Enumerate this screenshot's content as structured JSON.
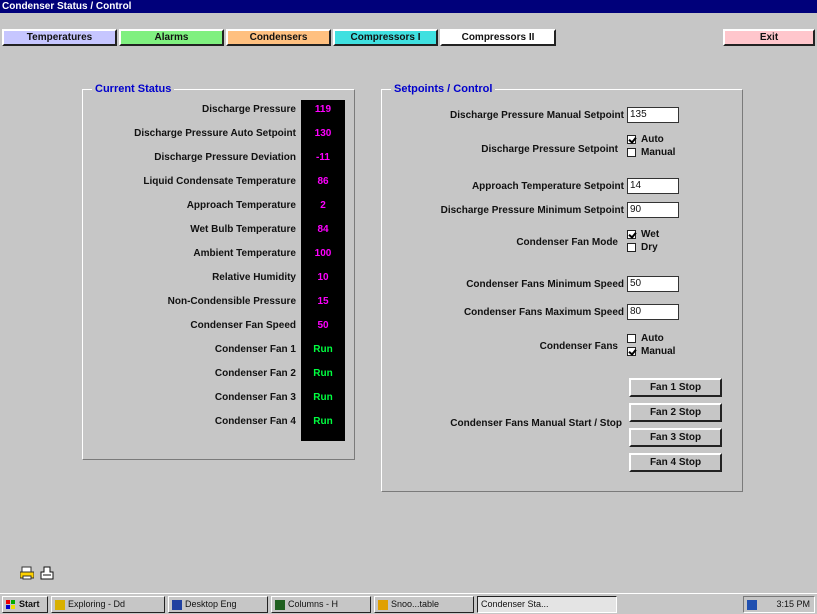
{
  "window": {
    "title": "Condenser Status / Control"
  },
  "nav": {
    "temperatures": "Temperatures",
    "alarms": "Alarms",
    "condensers": "Condensers",
    "compressors_1": "Compressors I",
    "compressors_2": "Compressors II",
    "exit": "Exit"
  },
  "status": {
    "title": "Current Status",
    "rows": [
      {
        "label": "Discharge Pressure",
        "value": "119"
      },
      {
        "label": "Discharge Pressure Auto Setpoint",
        "value": "130"
      },
      {
        "label": "Discharge Pressure Deviation",
        "value": "-11"
      },
      {
        "label": "Liquid Condensate Temperature",
        "value": "86"
      },
      {
        "label": "Approach Temperature",
        "value": "2"
      },
      {
        "label": "Wet Bulb Temperature",
        "value": "84"
      },
      {
        "label": "Ambient Temperature",
        "value": "100"
      },
      {
        "label": "Relative Humidity",
        "value": "10"
      },
      {
        "label": "Non-Condensible Pressure",
        "value": "15"
      },
      {
        "label": "Condenser Fan Speed",
        "value": "50"
      },
      {
        "label": "Condenser Fan 1",
        "value": "Run"
      },
      {
        "label": "Condenser Fan 2",
        "value": "Run"
      },
      {
        "label": "Condenser Fan 3",
        "value": "Run"
      },
      {
        "label": "Condenser Fan 4",
        "value": "Run"
      }
    ]
  },
  "setpoints": {
    "title": "Setpoints / Control",
    "discharge_manual_label": "Discharge Pressure Manual Setpoint",
    "discharge_manual_value": "135",
    "discharge_setpoint_label": "Discharge Pressure Setpoint",
    "discharge_auto": "Auto",
    "discharge_manual": "Manual",
    "approach_label": "Approach Temperature Setpoint",
    "approach_value": "14",
    "discharge_min_label": "Discharge Pressure Minimum Setpoint",
    "discharge_min_value": "90",
    "fan_mode_label": "Condenser Fan Mode",
    "fan_mode_wet": "Wet",
    "fan_mode_dry": "Dry",
    "fans_min_label": "Condenser Fans Minimum Speed",
    "fans_min_value": "50",
    "fans_max_label": "Condenser Fans Maximum Speed",
    "fans_max_value": "80",
    "fans_label": "Condenser Fans",
    "fans_auto": "Auto",
    "fans_manual": "Manual",
    "fans_startstop_label": "Condenser Fans Manual Start / Stop",
    "fan_buttons": [
      "Fan 1 Stop",
      "Fan 2 Stop",
      "Fan 3 Stop",
      "Fan 4 Stop"
    ]
  },
  "taskbar": {
    "start": "Start",
    "items": [
      "Exploring - Dd",
      "Desktop Eng",
      "Columns - H",
      "Snoo...table",
      "Condenser Sta..."
    ],
    "clock": "3:15 PM"
  },
  "colors": {
    "title_bar": "#00007a",
    "panel_title": "#0000cc",
    "value_magenta": "#ff00ff",
    "value_green": "#00ff40"
  },
  "icons": [
    "printer-icon",
    "print-preview-icon",
    "windows-logo-icon",
    "tray-icon"
  ]
}
